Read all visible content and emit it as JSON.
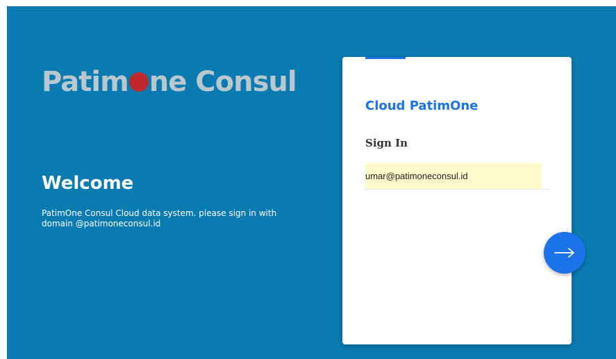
{
  "logo": {
    "part1": "Patim",
    "part2": "ne Consul",
    "o_color": "#c0282d"
  },
  "welcome": {
    "title": "Welcome",
    "text": "PatimOne Consul Cloud data system. please sign in with domain @patimoneconsul.id"
  },
  "card": {
    "title": "Cloud PatimOne",
    "signin_label": "Sign In",
    "email_value": "umar@patimoneconsul.id"
  },
  "next_button": {
    "icon": "arrow-right-icon"
  },
  "colors": {
    "background": "#0a7bb1",
    "accent": "#1a73e8",
    "input_autofill": "#fffacb"
  }
}
